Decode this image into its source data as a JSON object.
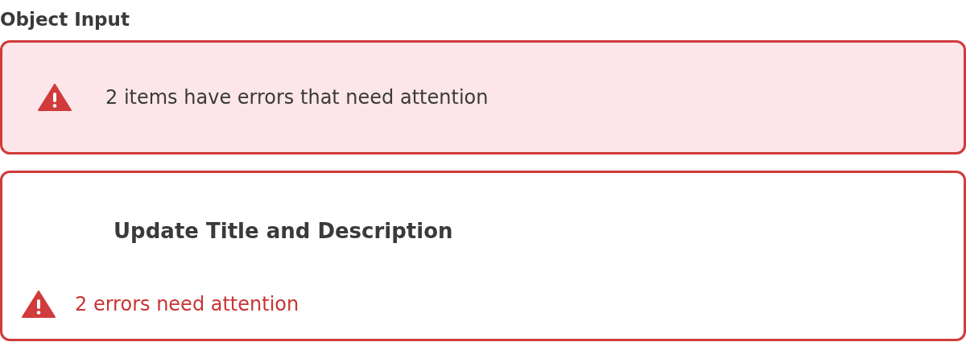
{
  "title": "Object Input",
  "banner": {
    "message": "2 items have errors that need attention"
  },
  "item": {
    "title": "Update Title and Description",
    "has_errors": true,
    "error_text": "2 errors need attention"
  }
}
